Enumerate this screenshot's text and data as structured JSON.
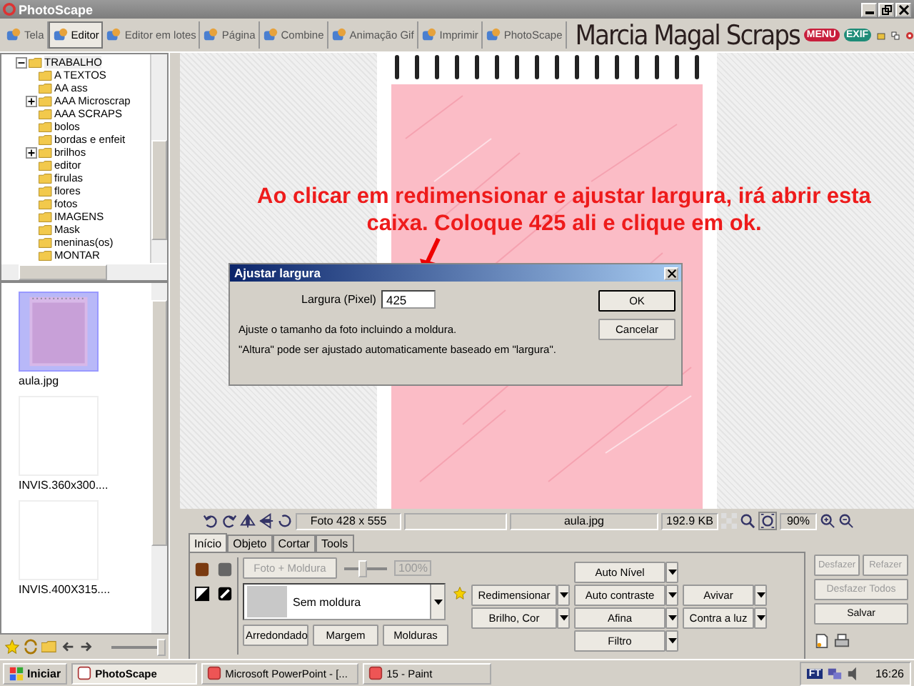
{
  "window": {
    "title": "PhotoScape"
  },
  "tabs": [
    {
      "label": "Tela",
      "selected": false
    },
    {
      "label": "Editor",
      "selected": true
    },
    {
      "label": "Editor em lotes",
      "selected": false
    },
    {
      "label": "Página",
      "selected": false
    },
    {
      "label": "Combine",
      "selected": false
    },
    {
      "label": "Animação Gif",
      "selected": false
    },
    {
      "label": "Imprimir",
      "selected": false
    },
    {
      "label": "PhotoScape",
      "selected": false
    }
  ],
  "brand": "Marcia Magal Scraps",
  "header_badges": [
    "MENU",
    "EXIF"
  ],
  "folder_tree": {
    "label": "TRABALHO",
    "expanded": true,
    "children": [
      {
        "label": "A TEXTOS",
        "expandable": false
      },
      {
        "label": "AA ass",
        "expandable": false
      },
      {
        "label": "AAA Microscrap",
        "expandable": true
      },
      {
        "label": "AAA SCRAPS",
        "expandable": false
      },
      {
        "label": "bolos",
        "expandable": false
      },
      {
        "label": "bordas e enfeit",
        "expandable": false
      },
      {
        "label": "brilhos",
        "expandable": true
      },
      {
        "label": "editor",
        "expandable": false
      },
      {
        "label": "firulas",
        "expandable": false
      },
      {
        "label": "flores",
        "expandable": false
      },
      {
        "label": "fotos",
        "expandable": false
      },
      {
        "label": "IMAGENS",
        "expandable": false
      },
      {
        "label": "Mask",
        "expandable": false
      },
      {
        "label": "meninas(os)",
        "expandable": false
      },
      {
        "label": "MONTAR",
        "expandable": false
      }
    ]
  },
  "thumbnails": [
    {
      "name": "aula.jpg",
      "kind": "picture",
      "selected": true
    },
    {
      "name": "INVIS.360x300....",
      "kind": "blank",
      "selected": false
    },
    {
      "name": "INVIS.400X315....",
      "kind": "blank",
      "selected": false
    }
  ],
  "thumbnail_size": {
    "level": 1
  },
  "status_bar": {
    "photo_size": "Foto 428 x 555",
    "file_name": "aula.jpg",
    "file_size": "192.9 KB",
    "zoom": "90%"
  },
  "panel_tabs": [
    {
      "label": "Início",
      "selected": true
    },
    {
      "label": "Objeto",
      "selected": false
    },
    {
      "label": "Cortar",
      "selected": false
    },
    {
      "label": "Tools",
      "selected": false
    }
  ],
  "frame": {
    "photo_frame_button": {
      "label": "Foto + Moldura",
      "disabled": true
    },
    "level": 0.4,
    "percent": "100%",
    "frame_name": "Sem moldura",
    "buttons": [
      "Arredondado",
      "Margem",
      "Molduras"
    ]
  },
  "adjust_columns": [
    [
      "Redimensionar",
      "Brilho, Cor"
    ],
    [
      "Auto Nível",
      "Auto contraste",
      "Afina",
      "Filtro"
    ],
    [
      "Avivar",
      "Contra a luz"
    ]
  ],
  "history_buttons": [
    {
      "label": "Desfazer",
      "disabled": true
    },
    {
      "label": "Refazer",
      "disabled": true
    },
    {
      "label": "Desfazer Todos",
      "disabled": true
    },
    {
      "label": "Salvar",
      "disabled": false
    }
  ],
  "taskbar": {
    "start": "Iniciar",
    "tasks": [
      {
        "label": "PhotoScape",
        "selected": true
      },
      {
        "label": "Microsoft PowerPoint - [...",
        "selected": false
      },
      {
        "label": "15 - Paint",
        "selected": false
      }
    ],
    "tray_badge": "FT",
    "clock": "16:26"
  },
  "annotation": "Ao clicar em redimensionar e ajustar largura, irá abrir esta caixa. Coloque 425 ali e clique em ok.",
  "dialog": {
    "title": "Ajustar largura",
    "field_label": "Largura (Pixel)",
    "value": "425",
    "buttons": [
      "OK",
      "Cancelar"
    ],
    "notes": [
      "Ajuste o tamanho da foto incluindo a moldura.",
      "\"Altura\" pode ser ajustado automaticamente baseado em \"largura\"."
    ]
  }
}
